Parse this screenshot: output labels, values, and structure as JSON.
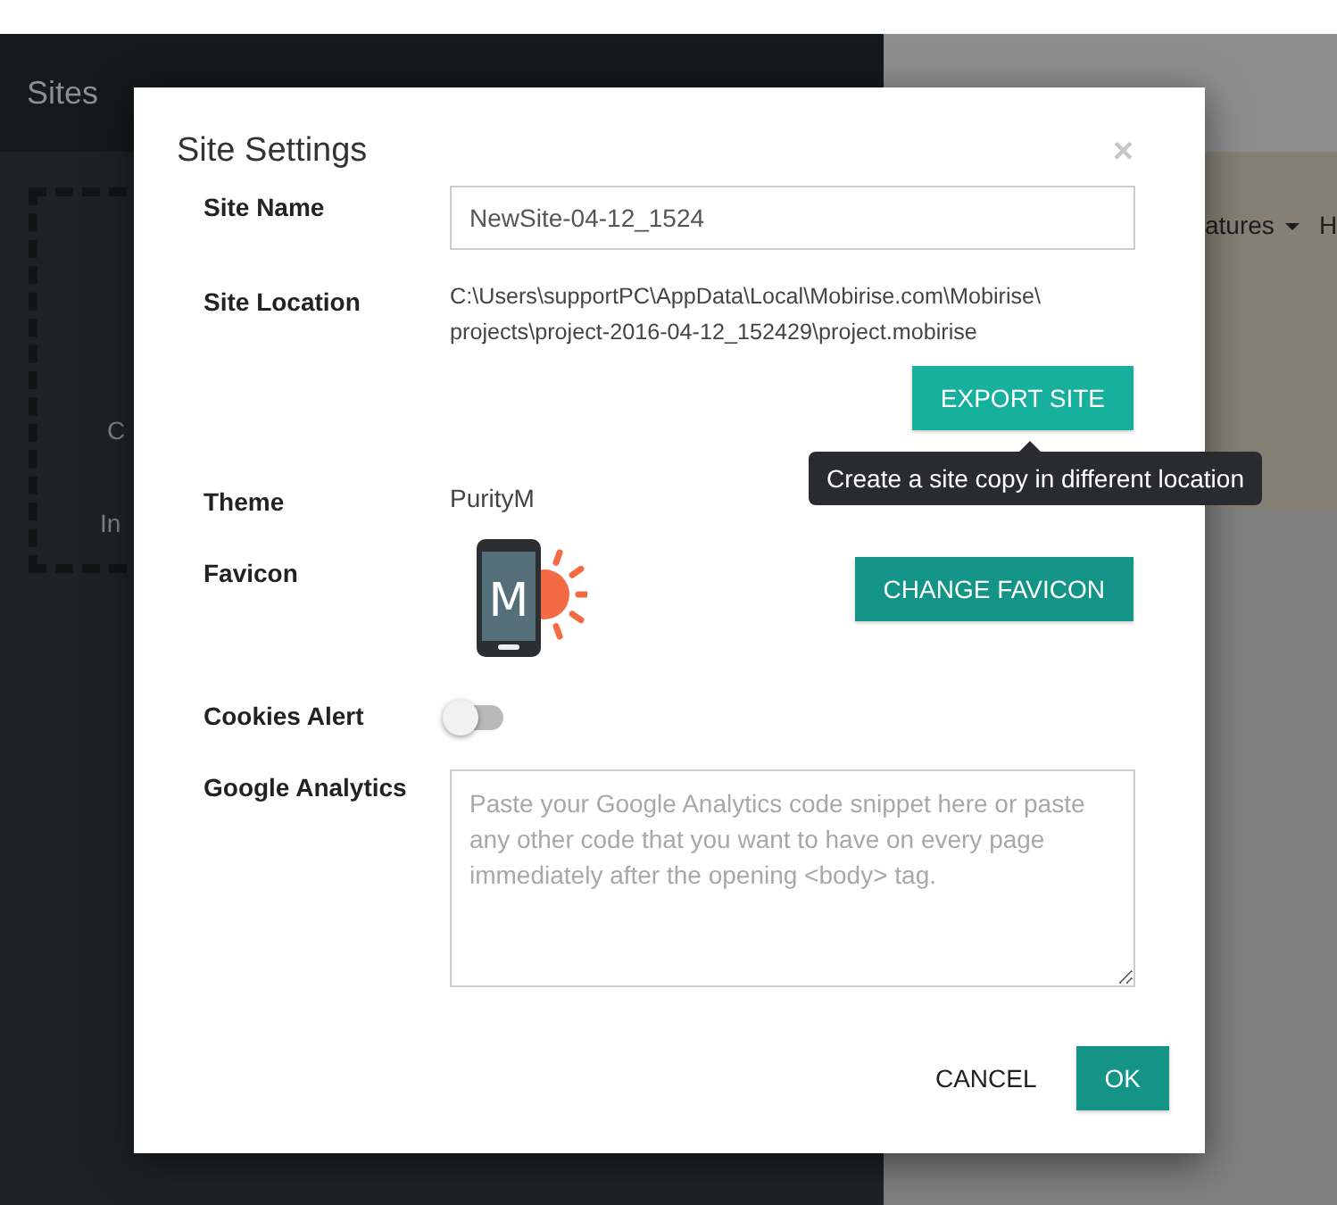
{
  "background": {
    "sidebar_title": "Sites",
    "sidebar_fragments": [
      "C",
      "In"
    ],
    "menu_fragments": [
      "atures",
      "H"
    ]
  },
  "dialog": {
    "title": "Site Settings",
    "close": "×",
    "fields": [
      {
        "kind": "input",
        "label": "Site Name",
        "value": "NewSite-04-12_1524"
      },
      {
        "kind": "path",
        "label": "Site Location",
        "value_lines": [
          "C:\\Users\\supportPC\\AppData\\Local\\Mobirise.com\\Mobirise\\",
          "projects\\project-2016-04-12_152429\\project.mobirise"
        ],
        "button": "EXPORT SITE",
        "tooltip": "Create a site copy in different location"
      },
      {
        "kind": "text",
        "label": "Theme",
        "value": "PurityM"
      },
      {
        "kind": "favicon",
        "label": "Favicon",
        "letter": "M",
        "button": "CHANGE FAVICON"
      },
      {
        "kind": "toggle",
        "label": "Cookies Alert",
        "on": false
      },
      {
        "kind": "textarea",
        "label": "Google Analytics",
        "placeholder": "Paste your Google Analytics code snippet here or paste any other code that you want to have on every page immediately after the opening <body> tag."
      }
    ],
    "buttons": [
      {
        "kind": "flat",
        "label": "CANCEL"
      },
      {
        "kind": "primary",
        "label": "OK"
      }
    ]
  }
}
